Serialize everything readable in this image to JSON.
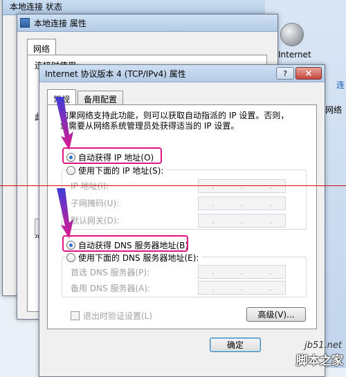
{
  "status_window": {
    "title": "本地连接 状态",
    "side_label": "Internet",
    "side_link": "连",
    "side_item": "网络"
  },
  "properties_window": {
    "title": "本地连接 属性",
    "tab": "网络",
    "connect_using": "连接时使用:",
    "partial_label": "此",
    "partial_label2": "描"
  },
  "ipv4_dialog": {
    "title": "Internet 协议版本 4 (TCP/IPv4) 属性",
    "help_btn": "?",
    "close_btn": "×",
    "tabs": [
      {
        "label": "常规"
      },
      {
        "label": "备用配置"
      }
    ],
    "description": "如果网络支持此功能，则可以获取自动指派的 IP 设置。否则，\n您需要从网络系统管理员处获得适当的 IP 设置。",
    "auto_ip_label": "自动获得 IP 地址(O)",
    "manual_ip_label": "使用下面的 IP 地址(S):",
    "ip_address_label": "IP 地址(I):",
    "subnet_label": "子网掩码(U):",
    "gateway_label": "默认网关(D):",
    "auto_dns_label": "自动获得 DNS 服务器地址(B)",
    "manual_dns_label": "使用下面的 DNS 服务器地址(E):",
    "preferred_dns_label": "首选 DNS 服务器(P):",
    "alternate_dns_label": "备用 DNS 服务器(A):",
    "validate_label": "退出时验证设置(L)",
    "advanced_btn": "高级(V)...",
    "ok_btn": "确定",
    "ip_dots": "."
  },
  "watermark": {
    "line1": "jb51.net",
    "line2": "脚本之家"
  },
  "colors": {
    "highlight": "#e0157f",
    "arrow": "#d70a8c",
    "red_line": "#e00000"
  }
}
